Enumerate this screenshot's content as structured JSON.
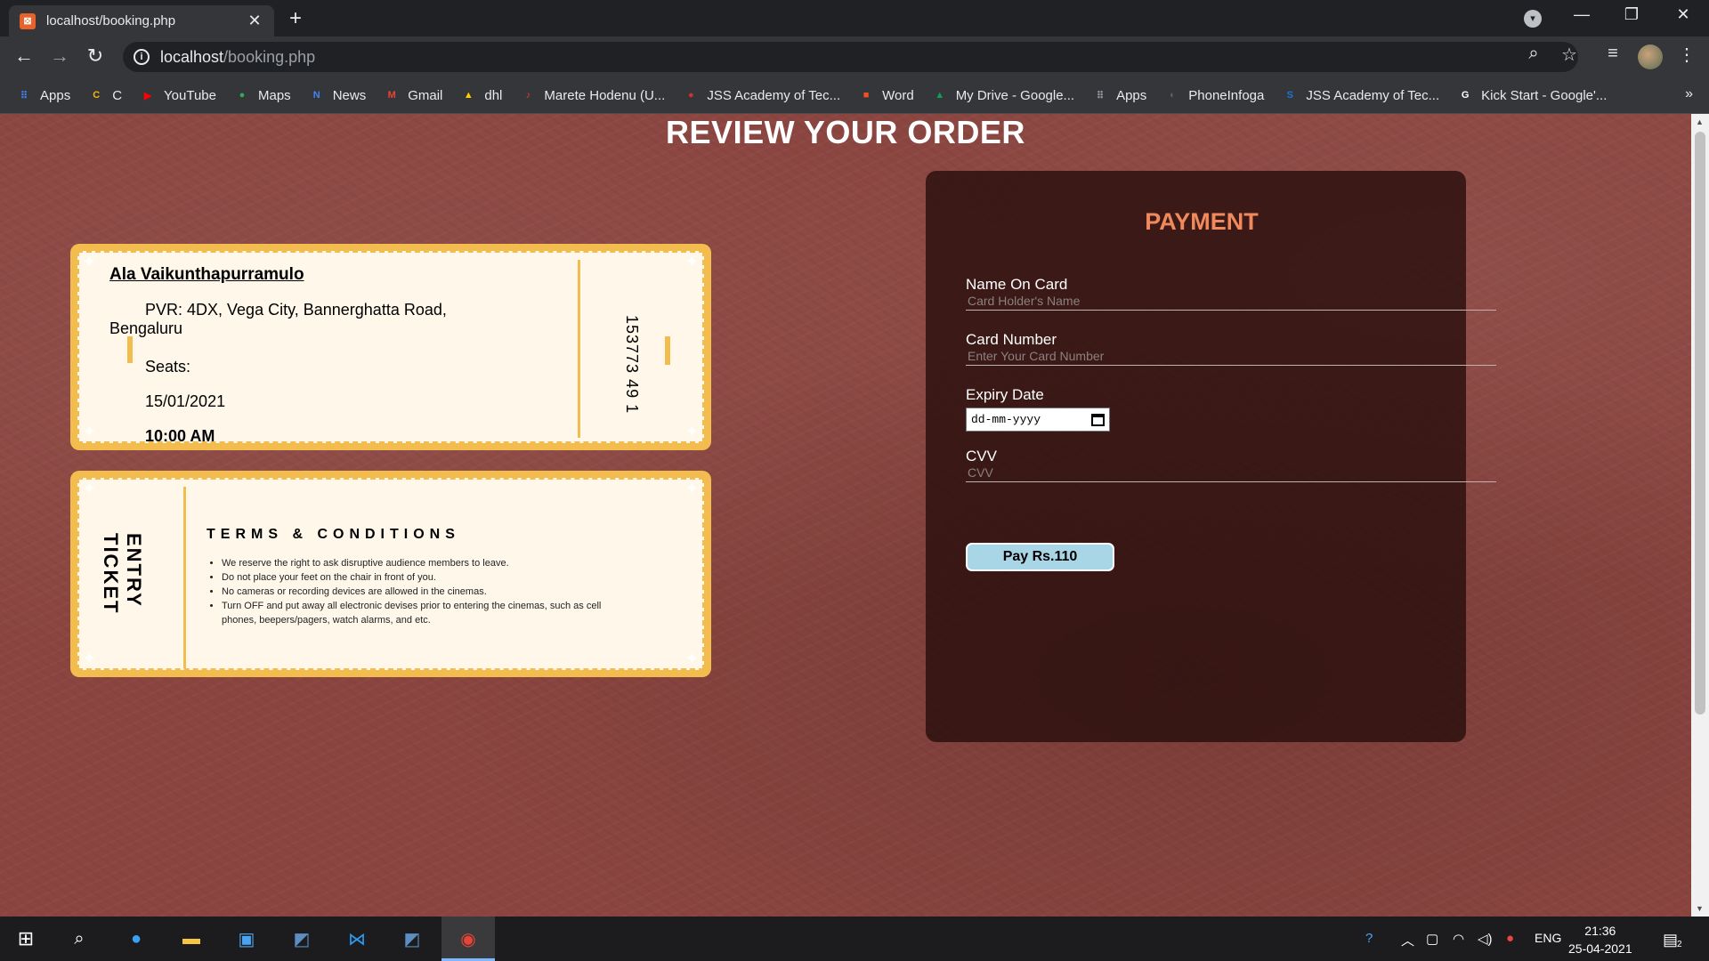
{
  "browser": {
    "tab_title": "localhost/booking.php",
    "tab_close": "✕",
    "new_tab": "+",
    "url_host": "localhost",
    "url_path": "/booking.php",
    "bookmarks": [
      {
        "label": "Apps",
        "icon": "apps-grid-icon",
        "color": "#4285f4"
      },
      {
        "label": "C",
        "icon": "c-icon",
        "color": "#f2b705"
      },
      {
        "label": "YouTube",
        "icon": "youtube-icon",
        "color": "#ff0000"
      },
      {
        "label": "Maps",
        "icon": "maps-pin-icon",
        "color": "#34a853"
      },
      {
        "label": "News",
        "icon": "news-icon",
        "color": "#4285f4"
      },
      {
        "label": "Gmail",
        "icon": "gmail-icon",
        "color": "#ea4335"
      },
      {
        "label": "dhl",
        "icon": "dhl-icon",
        "color": "#ffcc00"
      },
      {
        "label": "Marete Hodenu (U...",
        "icon": "music-icon",
        "color": "#e53935"
      },
      {
        "label": "JSS Academy of Tec...",
        "icon": "jss-icon",
        "color": "#d32f2f"
      },
      {
        "label": "Word",
        "icon": "microsoft-icon",
        "color": "#f25022"
      },
      {
        "label": "My Drive - Google...",
        "icon": "google-drive-icon",
        "color": "#0f9d58"
      },
      {
        "label": "Apps",
        "icon": "apps-grid-icon",
        "color": "#9aa0a6"
      },
      {
        "label": "PhoneInfoga",
        "icon": "phoneinfoga-icon",
        "color": "#5f6368"
      },
      {
        "label": "JSS Academy of Tec...",
        "icon": "s-icon",
        "color": "#1976d2"
      },
      {
        "label": "Kick Start - Google'...",
        "icon": "google-icon",
        "color": "#ffffff"
      }
    ],
    "bookmarks_more": "»"
  },
  "page": {
    "title": "REVIEW YOUR ORDER",
    "ticket": {
      "movie": "Ala Vaikunthapurramulo",
      "theatre": "PVR: 4DX, Vega City, Bannerghatta Road, Bengaluru",
      "seats_label": "Seats:",
      "date": "15/01/2021",
      "time": "10:00 AM",
      "stub_code": "153773 49 1"
    },
    "terms": {
      "entry_ticket": "ENTRY TICKET",
      "heading": "TERMS & CONDITIONS",
      "items": [
        "We reserve the right to ask disruptive audience members to leave.",
        "Do not place your feet on the chair in front of you.",
        "No cameras or recording devices are allowed in the cinemas.",
        "Turn OFF and put away all electronic devises prior to entering the cinemas, such as cell phones, beepers/pagers, watch alarms, and etc."
      ]
    },
    "payment": {
      "title": "PAYMENT",
      "name_label": "Name On Card",
      "name_placeholder": "Card Holder's Name",
      "card_label": "Card Number",
      "card_placeholder": "Enter Your Card Number",
      "expiry_label": "Expiry Date",
      "expiry_placeholder": "dd-mm-yyyy",
      "cvv_label": "CVV",
      "cvv_placeholder": "CVV",
      "pay_button": "Pay Rs.110"
    }
  },
  "taskbar": {
    "language": "ENG",
    "time": "21:36",
    "date": "25-04-2021",
    "notifications": "2"
  },
  "colors": {
    "page_bg": "#8b4540",
    "ticket_gold": "#f2bd4e",
    "ticket_paper": "#fff8ea",
    "payment_title": "#f08a5d",
    "pay_button": "#a9d6e6"
  }
}
